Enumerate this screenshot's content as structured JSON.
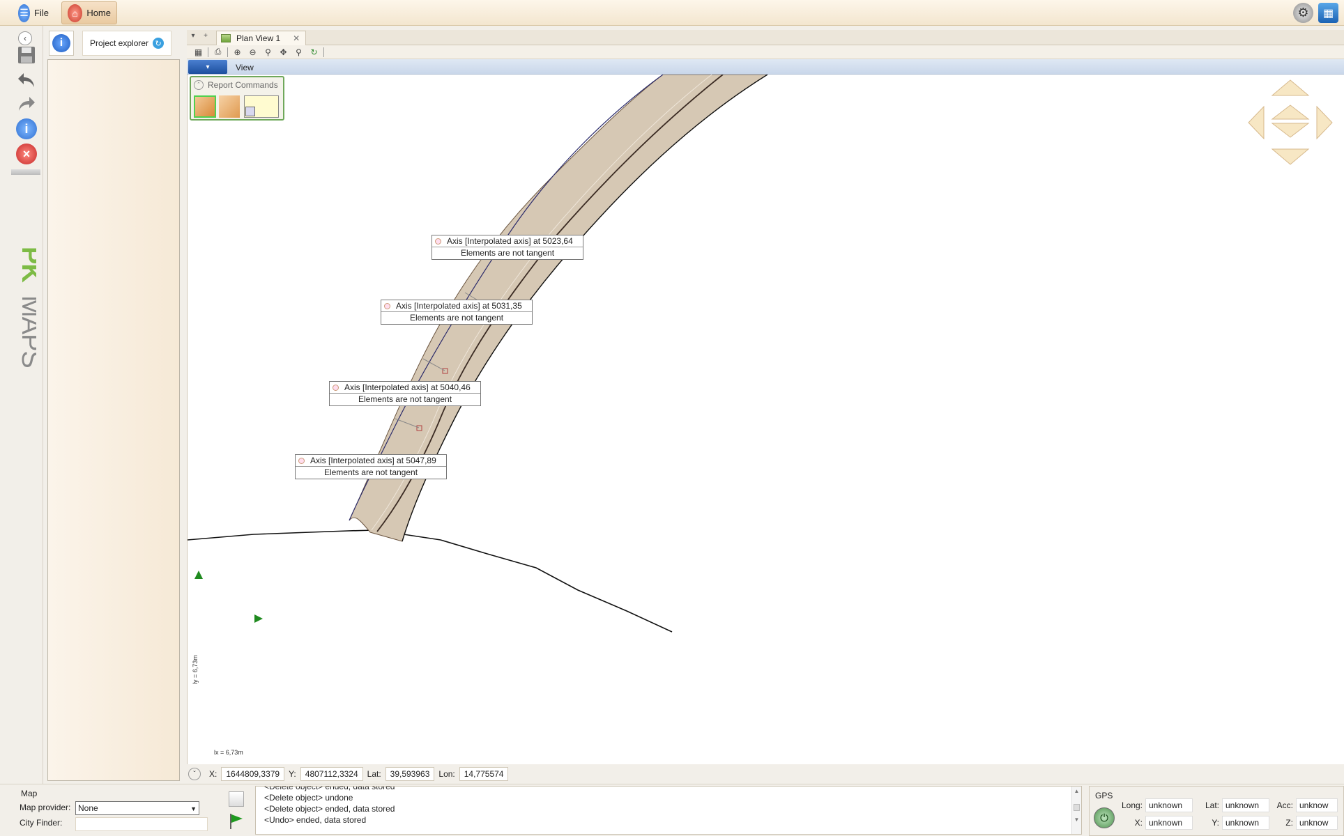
{
  "topbar": {
    "file_label": "File",
    "home_label": "Home",
    "settings_icon": "settings-gear-icon",
    "window_icon": "window-layout-icon"
  },
  "lefttools": {
    "logo_text": "PKMAPS",
    "brand_colors": {
      "pk": "#7dbb45",
      "maps": "#8a8a8a"
    }
  },
  "explorer": {
    "tab_label": "Project explorer"
  },
  "document": {
    "tab_title": "Plan View 1",
    "ribbon_tab": "View"
  },
  "report_commands": {
    "title": "Report Commands"
  },
  "callouts": [
    {
      "title": "Axis [Interpolated axis] at 5023,64",
      "message": "Elements are not tangent"
    },
    {
      "title": "Axis [Interpolated axis] at 5031,35",
      "message": "Elements are not tangent"
    },
    {
      "title": "Axis [Interpolated axis] at 5040,46",
      "message": "Elements are not tangent"
    },
    {
      "title": "Axis [Interpolated axis] at 5047,89",
      "message": "Elements are not tangent"
    }
  ],
  "scale": {
    "y_label": "ly = 6,73m",
    "x_label": "lx = 6,73m"
  },
  "coordinates": {
    "x_label": "X:",
    "x_value": "1644809,3379",
    "y_label": "Y:",
    "y_value": "4807112,3324",
    "lat_label": "Lat:",
    "lat_value": "39,593963",
    "lon_label": "Lon:",
    "lon_value": "14,775574"
  },
  "map": {
    "title": "Map",
    "provider_label": "Map provider:",
    "provider_value": "None",
    "city_label": "City Finder:",
    "city_value": ""
  },
  "log": {
    "lines": [
      "<Delete object> ended, data stored",
      "<Delete object> undone",
      "<Delete object> ended, data stored",
      "<Undo> ended, data stored"
    ]
  },
  "gps": {
    "title": "GPS",
    "long_label": "Long:",
    "long_value": "unknown",
    "lat_label": "Lat:",
    "lat_value": "unknown",
    "acc_label": "Acc:",
    "acc_value": "unknow",
    "x_label": "X:",
    "x_value": "unknown",
    "y_label": "Y:",
    "y_value": "unknown",
    "z_label": "Z:",
    "z_value": "unknow"
  }
}
